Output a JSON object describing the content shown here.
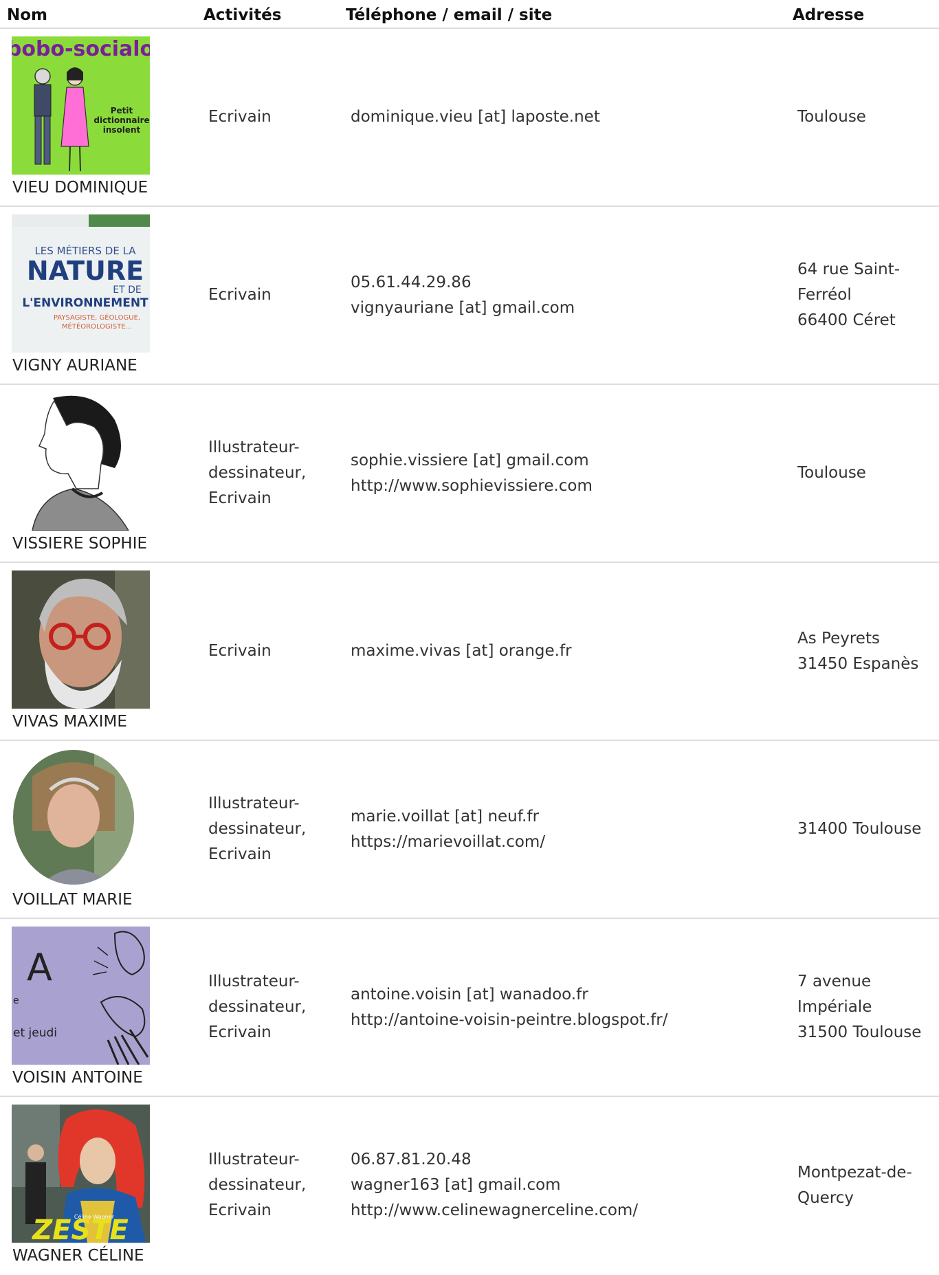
{
  "headers": {
    "nom": "Nom",
    "activites": "Activités",
    "contact": "Téléphone / email / site",
    "adresse": "Adresse"
  },
  "entries": [
    {
      "name": "VIEU DOMINIQUE",
      "thumb_icon": "book-cover-bobo-socialo",
      "thumb_title": "bobo-socialo",
      "thumb_subtitle": [
        "Petit",
        "dictionnaire",
        "insolent"
      ],
      "activities": [
        "Ecrivain"
      ],
      "contact": [
        "dominique.vieu [at] laposte.net"
      ],
      "address": [
        "Toulouse"
      ]
    },
    {
      "name": "VIGNY AURIANE",
      "thumb_icon": "book-cover-metiers-nature",
      "thumb_lines": [
        "LES MÉTIERS DE LA",
        "NATURE",
        "ET DE",
        "L'ENVIRONNEMENT",
        "PAYSAGISTE, GÉOLOGUE,",
        "MÉTÉOROLOGISTE..."
      ],
      "activities": [
        "Ecrivain"
      ],
      "contact": [
        "05.61.44.29.86",
        "vignyauriane [at] gmail.com"
      ],
      "address": [
        "64 rue Saint-",
        "Ferréol",
        "66400 Céret"
      ]
    },
    {
      "name": "VISSIERE SOPHIE",
      "thumb_icon": "portrait-drawing",
      "activities": [
        "Illustrateur-",
        "dessinateur,",
        "Ecrivain"
      ],
      "contact": [
        "sophie.vissiere [at] gmail.com",
        "http://www.sophievissiere.com"
      ],
      "address": [
        "Toulouse"
      ]
    },
    {
      "name": "VIVAS MAXIME",
      "thumb_icon": "portrait-photo",
      "activities": [
        "Ecrivain"
      ],
      "contact": [
        "maxime.vivas [at] orange.fr"
      ],
      "address": [
        "As Peyrets",
        "31450 Espanès"
      ]
    },
    {
      "name": "VOILLAT MARIE",
      "thumb_icon": "portrait-oval-photo",
      "activities": [
        "Illustrateur-",
        "dessinateur,",
        "Ecrivain"
      ],
      "contact": [
        "marie.voillat [at] neuf.fr",
        "https://marievoillat.com/"
      ],
      "address": [
        "31400 Toulouse"
      ]
    },
    {
      "name": "VOISIN ANTOINE",
      "thumb_icon": "poster-illustration",
      "thumb_lines": [
        "A",
        "e",
        "et jeudi"
      ],
      "activities": [
        "Illustrateur-",
        "dessinateur,",
        "Ecrivain"
      ],
      "contact": [
        "antoine.voisin [at] wanadoo.fr",
        "http://antoine-voisin-peintre.blogspot.fr/"
      ],
      "address": [
        "7 avenue",
        "Impériale",
        "31500 Toulouse"
      ]
    },
    {
      "name": "WAGNER CÉLINE",
      "thumb_icon": "book-cover-zeste",
      "thumb_title": "ZESTE",
      "thumb_author": "Céline Wagner",
      "activities": [
        "Illustrateur-",
        "dessinateur,",
        "Ecrivain"
      ],
      "contact": [
        "06.87.81.20.48",
        "wagner163 [at] gmail.com",
        "http://www.celinewagnerceline.com/"
      ],
      "address": [
        "Montpezat-de-",
        "Quercy"
      ]
    }
  ],
  "colors": {
    "text": "#333333",
    "header_text": "#111111",
    "row_border": "#dddddd"
  }
}
